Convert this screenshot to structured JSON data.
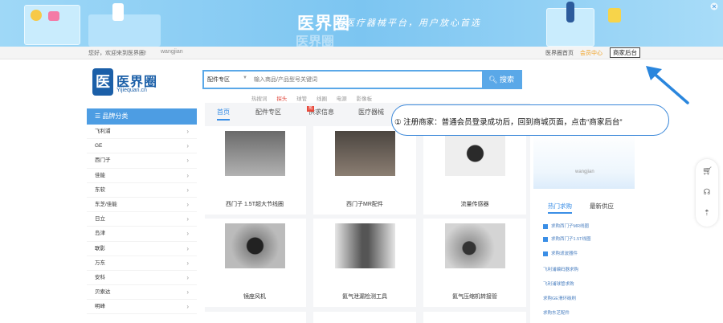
{
  "banner": {
    "site_name": "医界圈",
    "slogan": "医疗器械平台，用户放心首选",
    "ghost_text": "医界圈"
  },
  "topbar": {
    "welcome": "您好，欢迎来到医界圈!",
    "username": "wangjian",
    "home_link": "医界圈首页",
    "guide": "会员中心",
    "merchant_button": "商家后台"
  },
  "header": {
    "logo_char": "医",
    "site_name": "医界圈",
    "domain": "Yijiequan.cn"
  },
  "search": {
    "category": "配件专区",
    "placeholder": "输入商品/产品型号关键词",
    "button": "搜索",
    "hotwords": [
      "热搜词",
      "探头",
      "球管",
      "线圈",
      "电源",
      "影像板"
    ]
  },
  "sidebar": {
    "header": "品牌分类",
    "items": [
      "飞利浦",
      "GE",
      "西门子",
      "佳能",
      "东软",
      "东芝/佳能",
      "日立",
      "岛津",
      "联影",
      "万东",
      "安科",
      "贝索达",
      "明峰"
    ]
  },
  "tabs": [
    "首页",
    "配件专区",
    "供求信息",
    "医疗器械"
  ],
  "tab_badge": "热",
  "products": [
    {
      "name": "西门子 1.5T超大节线圈"
    },
    {
      "name": "西门子MR配件"
    },
    {
      "name": "流量传感器"
    },
    {
      "name": "镜座风机"
    },
    {
      "name": "氦气泄漏检测工具"
    },
    {
      "name": "氦气压缩机转接管"
    }
  ],
  "right_panel": {
    "username": "wangjian",
    "tabs": [
      "热门求购",
      "最新供应"
    ],
    "items": [
      "求购西门子MR线圈",
      "求购西门子1.5T线圈",
      "求购滤波器件",
      "飞利浦编码器求购",
      "飞利浦球管求购",
      "求购GE滑环碳刷",
      "求购东芝配件"
    ]
  },
  "callout": {
    "text": "① 注册商家：普通会员登录成功后，回到商城页面，点击“商家后台”"
  },
  "colors": {
    "accent": "#3a8ee6",
    "banner": "#7cc5f1",
    "brand": "#1b5fa8"
  }
}
